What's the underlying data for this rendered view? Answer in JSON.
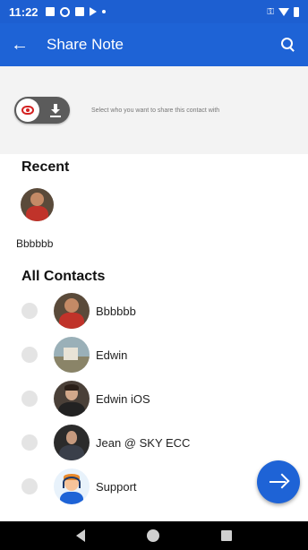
{
  "status_bar": {
    "time": "11:22"
  },
  "app_bar": {
    "title": "Share Note",
    "back_icon": "arrow-left-icon",
    "search_icon": "search-icon"
  },
  "share": {
    "hint": "Select who you want to share this contact with"
  },
  "recent": {
    "title": "Recent",
    "items": [
      {
        "name": "Bbbbbb"
      }
    ]
  },
  "all_contacts": {
    "title": "All Contacts",
    "items": [
      {
        "name": "Bbbbbb"
      },
      {
        "name": "Edwin"
      },
      {
        "name": "Edwin iOS"
      },
      {
        "name": "Jean @ SKY ECC"
      },
      {
        "name": "Support"
      }
    ]
  },
  "colors": {
    "primary": "#1e63d6",
    "status_bar": "#1d5fd1",
    "toggle_eye": "#d42121"
  }
}
